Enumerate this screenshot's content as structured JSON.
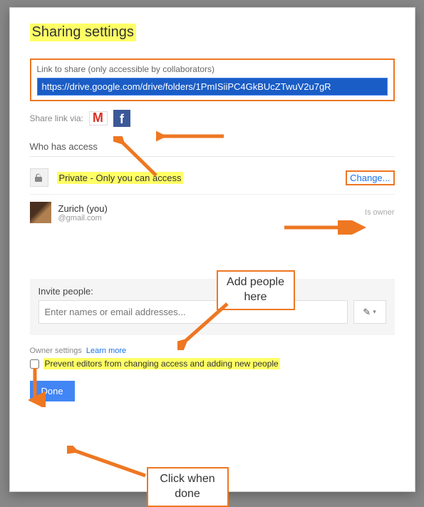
{
  "title": "Sharing settings",
  "linkSection": {
    "label": "Link to share (only accessible by collaborators)",
    "url": "https://drive.google.com/drive/folders/1PmISiiPC4GkBUcZTwuV2u7gR"
  },
  "shareVia": {
    "label": "Share link via:",
    "gmail": "Gmail",
    "facebook": "Facebook"
  },
  "whoHasAccess": "Who has access",
  "access": {
    "privacyText": "Private - Only you can access",
    "changeLabel": "Change..."
  },
  "owner": {
    "name": "Zurich (you)",
    "email": "@gmail.com",
    "role": "Is owner"
  },
  "invite": {
    "label": "Invite people:",
    "placeholder": "Enter names or email addresses..."
  },
  "ownerSettings": {
    "label": "Owner settings",
    "learnMore": "Learn more"
  },
  "preventText": "Prevent editors from changing access and adding new people",
  "doneLabel": "Done",
  "annotations": {
    "addPeople": "Add people here",
    "clickWhenDone": "Click when done"
  },
  "colors": {
    "highlight": "#ffff66",
    "annotation": "#ee7722"
  }
}
